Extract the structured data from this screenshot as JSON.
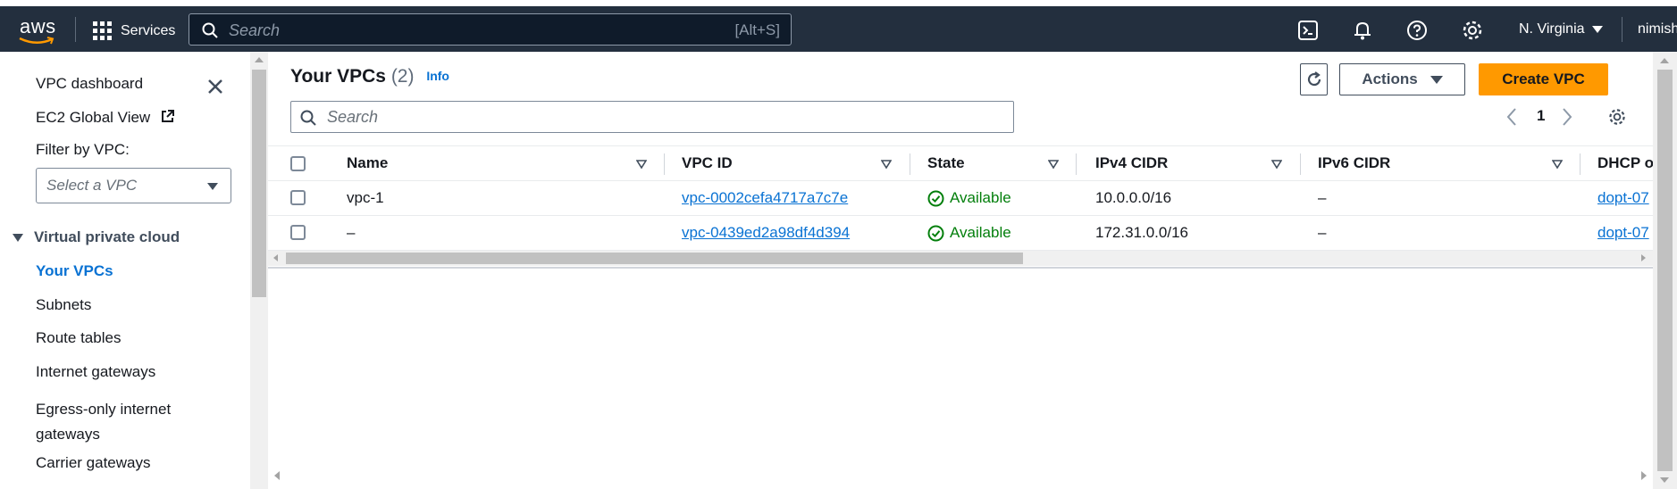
{
  "topnav": {
    "logo": "aws",
    "services": "Services",
    "search_placeholder": "Search",
    "search_shortcut": "[Alt+S]",
    "region": "N. Virginia",
    "user": "nimish",
    "icons": [
      "cloudshell-icon",
      "notifications-icon",
      "help-icon",
      "settings-icon"
    ]
  },
  "sidebar": {
    "dashboard": "VPC dashboard",
    "ec2_global": "EC2 Global View",
    "filter_label": "Filter by VPC:",
    "filter_placeholder": "Select a VPC",
    "section": "Virtual private cloud",
    "items": [
      {
        "label": "Your VPCs",
        "active": true
      },
      {
        "label": "Subnets",
        "active": false
      },
      {
        "label": "Route tables",
        "active": false
      },
      {
        "label": "Internet gateways",
        "active": false
      },
      {
        "label": "Egress-only internet gateways",
        "active": false
      },
      {
        "label": "Carrier gateways",
        "active": false
      }
    ]
  },
  "main": {
    "title": "Your VPCs",
    "count": "(2)",
    "info": "Info",
    "actions": "Actions",
    "create": "Create VPC",
    "search_placeholder": "Search",
    "page": "1",
    "columns": [
      "Name",
      "VPC ID",
      "State",
      "IPv4 CIDR",
      "IPv6 CIDR",
      "DHCP o"
    ],
    "rows": [
      {
        "name": "vpc-1",
        "vpc_id": "vpc-0002cefa4717a7c7e",
        "state": "Available",
        "ipv4": "10.0.0.0/16",
        "ipv6": "–",
        "dhcp": "dopt-07"
      },
      {
        "name": "–",
        "vpc_id": "vpc-0439ed2a98df4d394",
        "state": "Available",
        "ipv4": "172.31.0.0/16",
        "ipv6": "–",
        "dhcp": "dopt-07"
      }
    ]
  },
  "colors": {
    "nav_bg": "#232f3e",
    "link": "#0972d3",
    "primary": "#ff9900",
    "available": "#037f0c"
  }
}
